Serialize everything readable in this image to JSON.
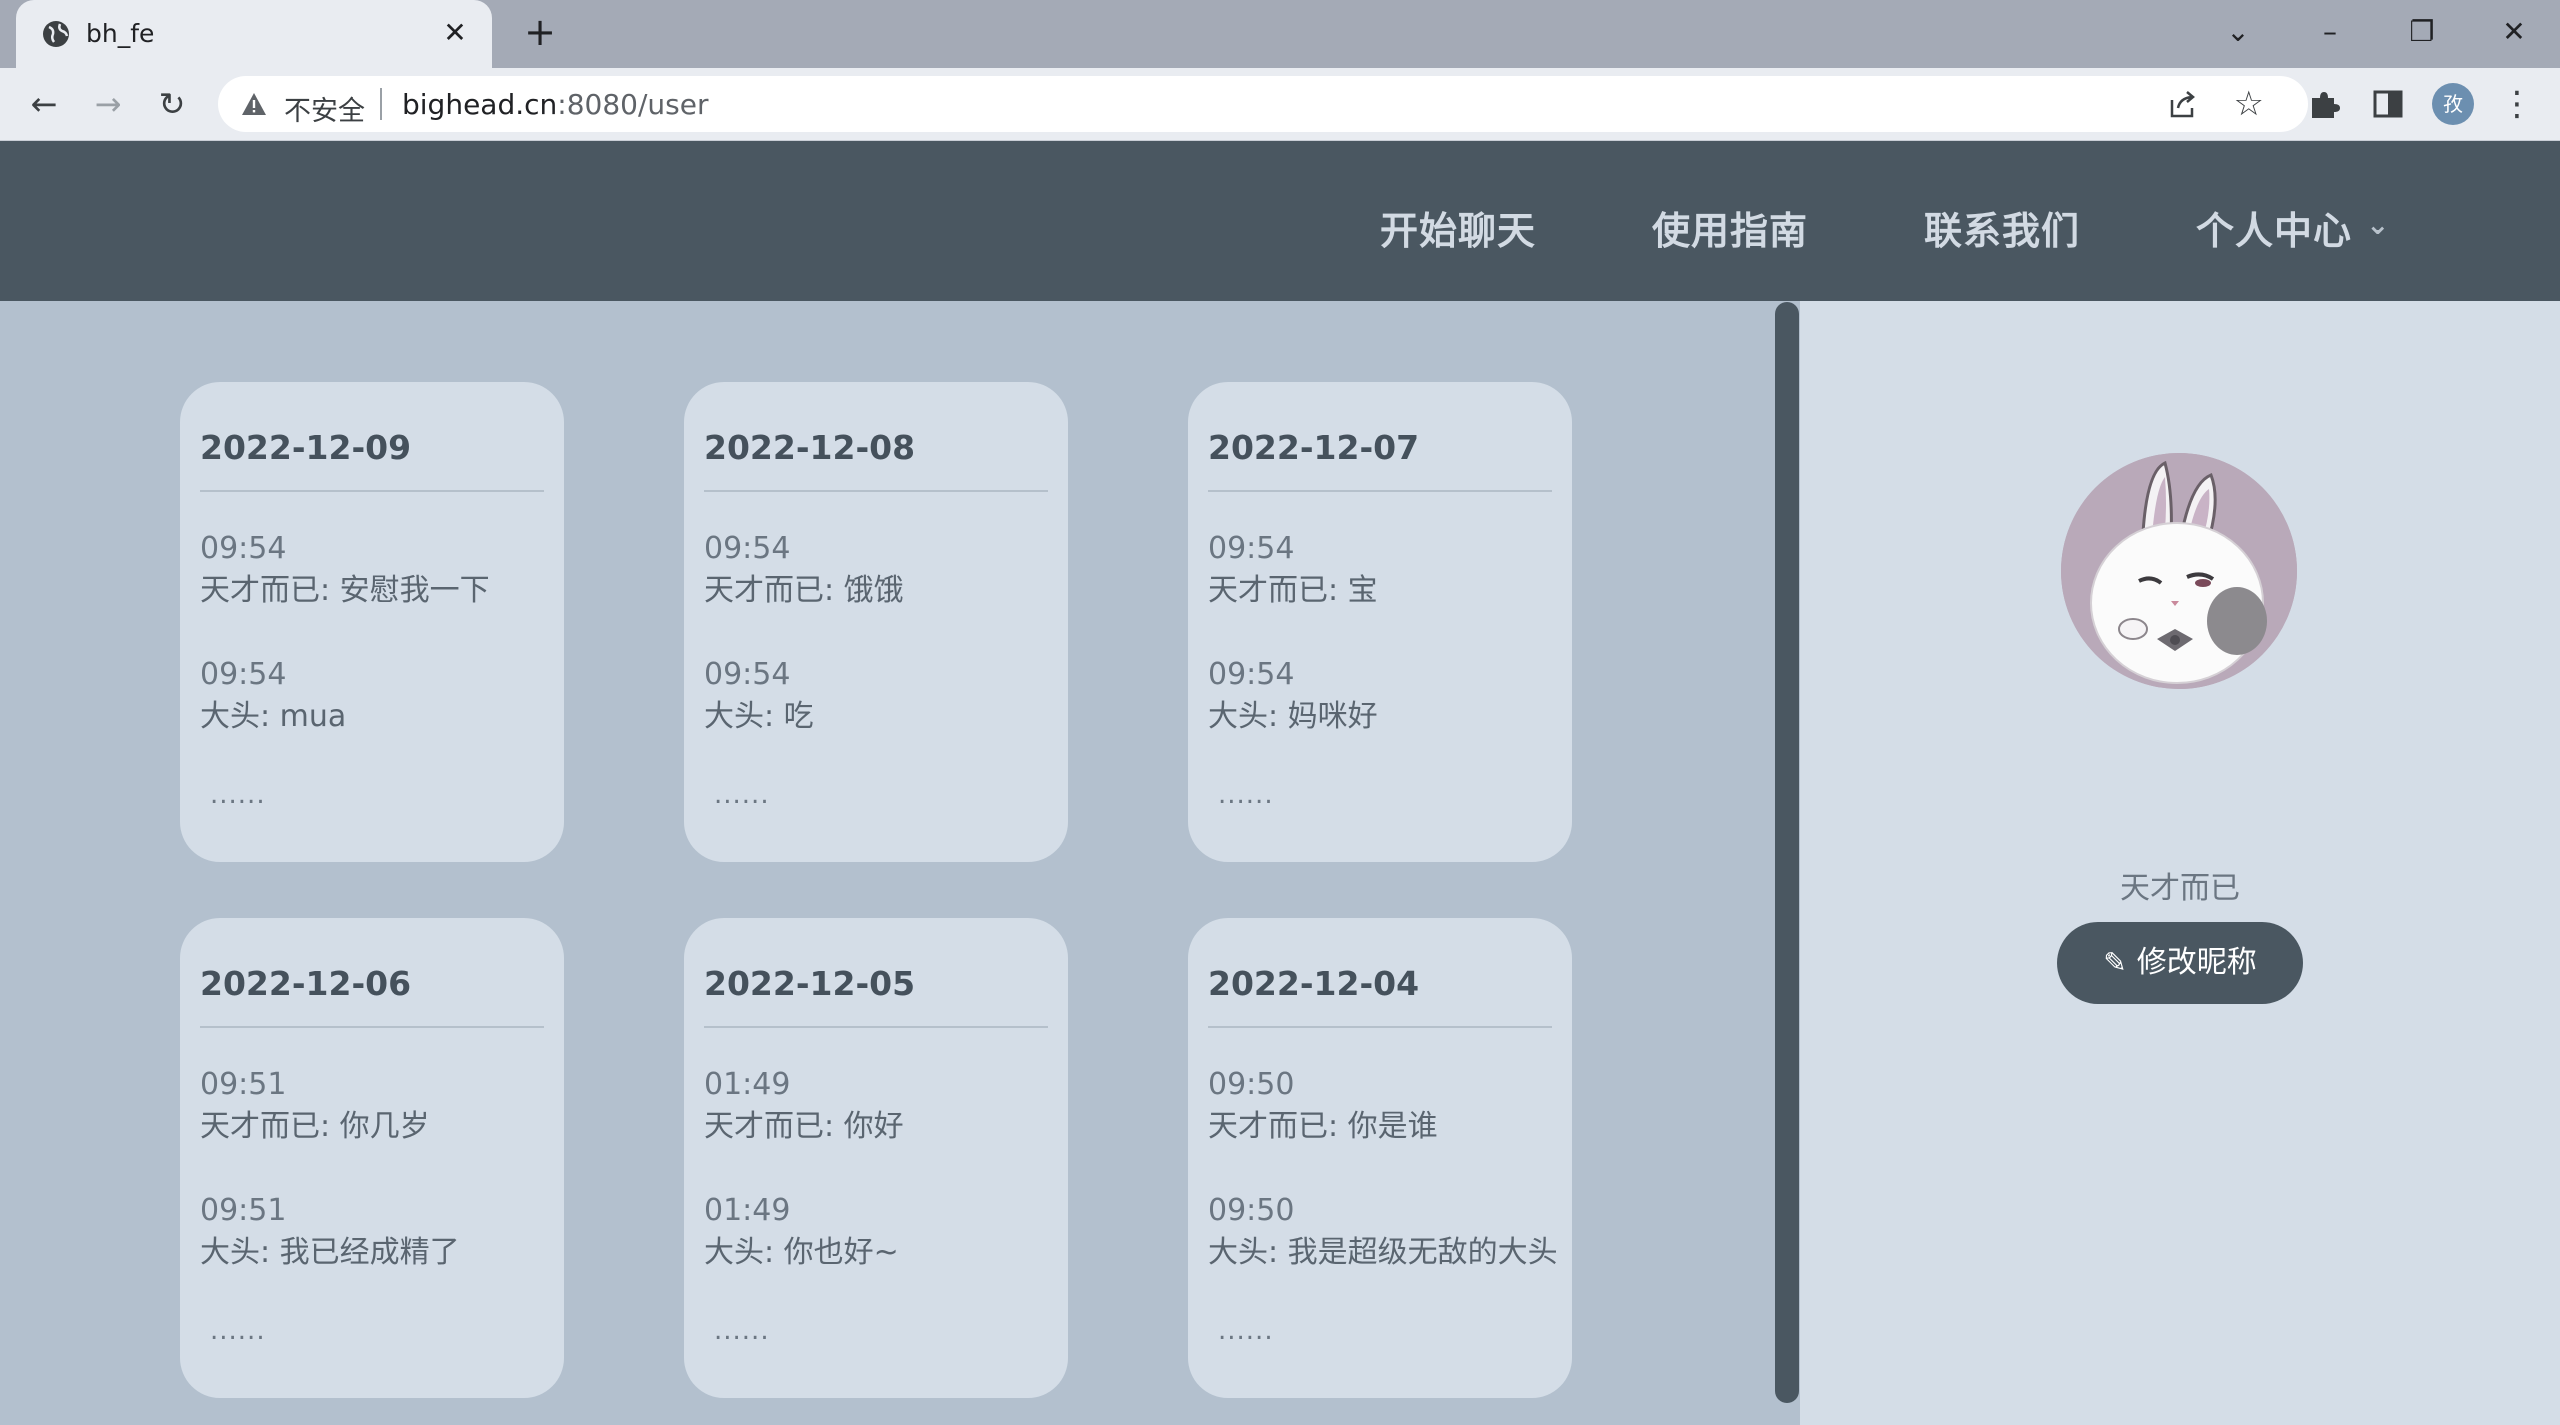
{
  "browser": {
    "tab_title": "bh_fe",
    "insecure_label": "不安全",
    "url_host": "bighead.cn",
    "url_rest": ":8080/user",
    "profile_initial": "孜"
  },
  "nav": {
    "items": [
      "开始聊天",
      "使用指南",
      "联系我们",
      "个人中心"
    ]
  },
  "cards": [
    {
      "date": "2022-12-09",
      "messages": [
        {
          "time": "09:54",
          "text": "天才而已: 安慰我一下"
        },
        {
          "time": "09:54",
          "text": "大头: mua"
        }
      ],
      "more": "......"
    },
    {
      "date": "2022-12-08",
      "messages": [
        {
          "time": "09:54",
          "text": "天才而已: 饿饿"
        },
        {
          "time": "09:54",
          "text": "大头: 吃"
        }
      ],
      "more": "......"
    },
    {
      "date": "2022-12-07",
      "messages": [
        {
          "time": "09:54",
          "text": "天才而已: 宝"
        },
        {
          "time": "09:54",
          "text": "大头: 妈咪好"
        }
      ],
      "more": "......"
    },
    {
      "date": "2022-12-06",
      "messages": [
        {
          "time": "09:51",
          "text": "天才而已: 你几岁"
        },
        {
          "time": "09:51",
          "text": "大头: 我已经成精了"
        }
      ],
      "more": "......"
    },
    {
      "date": "2022-12-05",
      "messages": [
        {
          "time": "01:49",
          "text": "天才而已: 你好"
        },
        {
          "time": "01:49",
          "text": "大头: 你也好~"
        }
      ],
      "more": "......"
    },
    {
      "date": "2022-12-04",
      "messages": [
        {
          "time": "09:50",
          "text": "天才而已: 你是谁"
        },
        {
          "time": "09:50",
          "text": "大头: 我是超级无敌的大头"
        }
      ],
      "more": "......"
    }
  ],
  "profile": {
    "username": "天才而已",
    "edit_button": "修改昵称",
    "avatar_icon": "white-rabbit-avatar"
  },
  "colors": {
    "header_bg": "#4a5761",
    "page_bg": "#b3c0ce",
    "card_bg": "#d4dde7",
    "accent": "#4a5761"
  }
}
